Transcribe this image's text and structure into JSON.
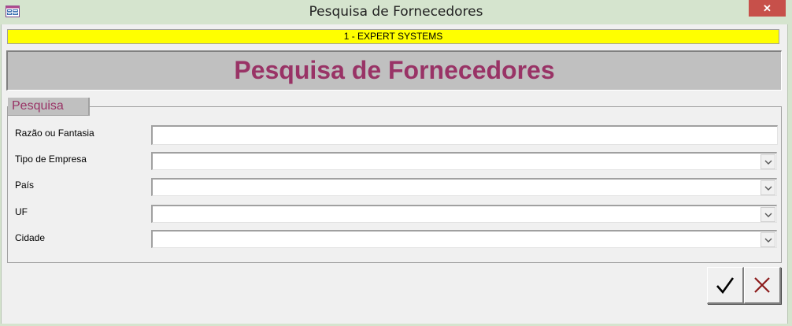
{
  "window": {
    "title": "Pesquisa de Fornecedores",
    "close_glyph": "✕",
    "icon": "access-form-icon"
  },
  "company_bar": {
    "text": "1 - EXPERT SYSTEMS",
    "color": "#ffff00"
  },
  "header": {
    "title": "Pesquisa de Fornecedores",
    "title_color": "#993366"
  },
  "group": {
    "label": "Pesquisa"
  },
  "fields": {
    "razao": {
      "label": "Razão ou Fantasia",
      "value": ""
    },
    "tipo_empresa": {
      "label": "Tipo de Empresa",
      "value": ""
    },
    "pais": {
      "label": "País",
      "value": ""
    },
    "uf": {
      "label": "UF",
      "value": ""
    },
    "cidade": {
      "label": "Cidade",
      "value": ""
    }
  },
  "actions": {
    "confirm_icon": "checkmark-icon",
    "cancel_icon": "x-cancel-icon"
  }
}
